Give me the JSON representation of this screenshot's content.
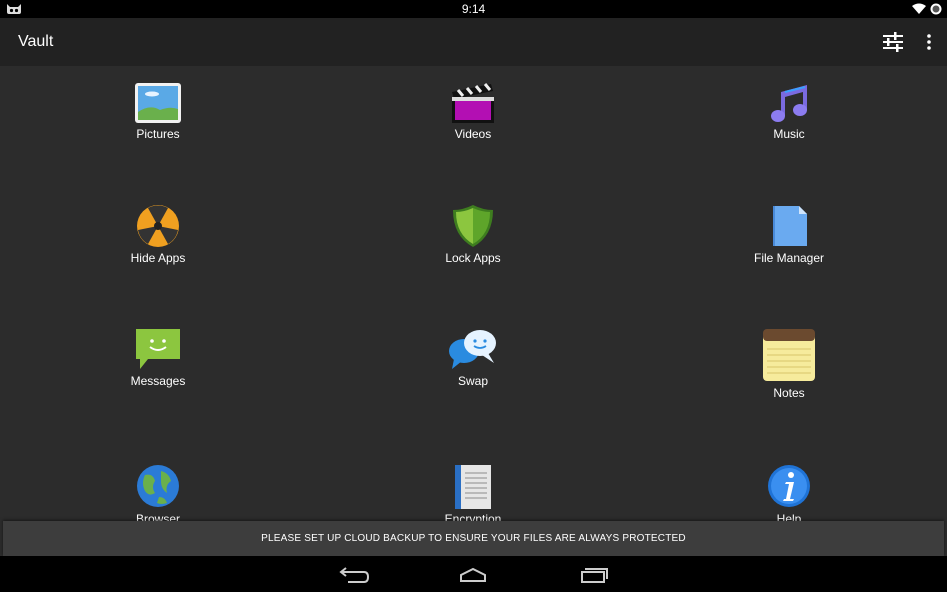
{
  "status_bar": {
    "time": "9:14"
  },
  "action_bar": {
    "title": "Vault"
  },
  "grid": {
    "items": [
      {
        "label": "Pictures",
        "icon": "pictures-icon"
      },
      {
        "label": "Videos",
        "icon": "videos-icon"
      },
      {
        "label": "Music",
        "icon": "music-icon"
      },
      {
        "label": "Hide Apps",
        "icon": "hide-apps-icon"
      },
      {
        "label": "Lock Apps",
        "icon": "lock-apps-icon"
      },
      {
        "label": "File Manager",
        "icon": "file-manager-icon"
      },
      {
        "label": "Messages",
        "icon": "messages-icon"
      },
      {
        "label": "Swap",
        "icon": "swap-icon"
      },
      {
        "label": "Notes",
        "icon": "notes-icon"
      },
      {
        "label": "Browser",
        "icon": "browser-icon"
      },
      {
        "label": "Encryption",
        "icon": "encryption-icon"
      },
      {
        "label": "Help",
        "icon": "help-icon"
      }
    ]
  },
  "snackbar": {
    "message": "PLEASE SET UP CLOUD BACKUP TO ENSURE YOUR FILES ARE ALWAYS PROTECTED"
  },
  "colors": {
    "action_bar": "#222222",
    "content": "#2c2c2c",
    "snackbar": "#3d3d3d"
  }
}
